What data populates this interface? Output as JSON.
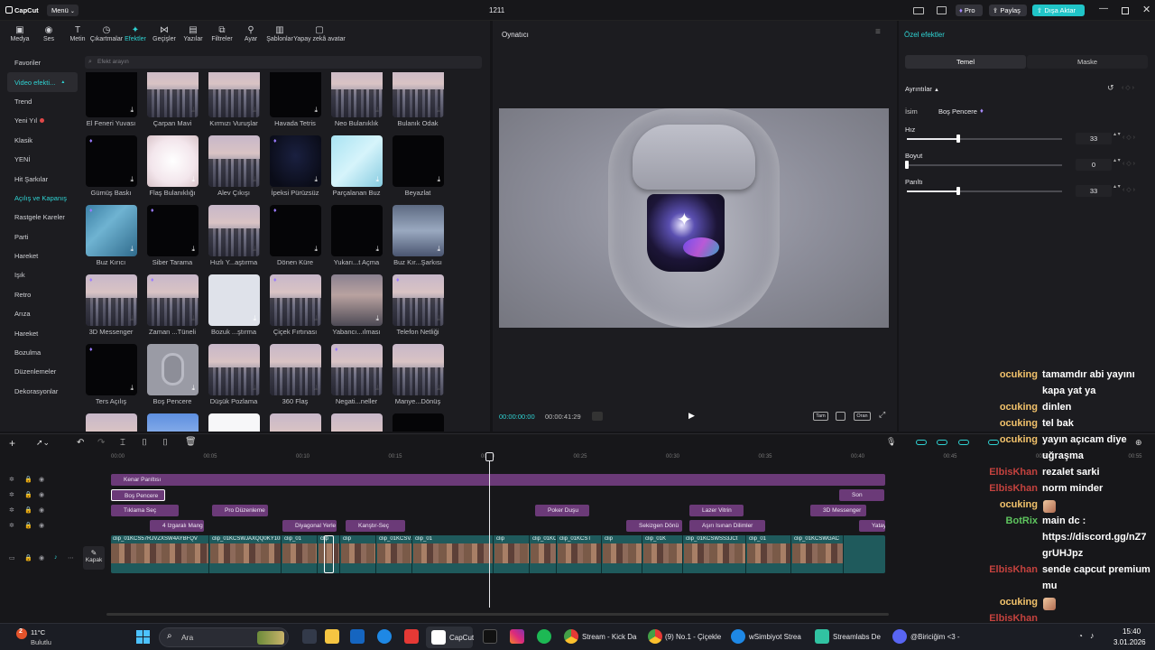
{
  "titlebar": {
    "app_name": "CapCut",
    "menu_label": "Menü",
    "project_title": "1211",
    "pro_label": "Pro",
    "share_label": "Paylaş",
    "export_label": "Dışa Aktar"
  },
  "toolbar": [
    {
      "label": "Medya",
      "icon": "media-icon"
    },
    {
      "label": "Ses",
      "icon": "audio-icon"
    },
    {
      "label": "Metin",
      "icon": "text-icon"
    },
    {
      "label": "Çıkartmalar",
      "icon": "sticker-icon"
    },
    {
      "label": "Efektler",
      "icon": "effects-icon",
      "active": true
    },
    {
      "label": "Geçişler",
      "icon": "transition-icon"
    },
    {
      "label": "Yazılar",
      "icon": "captions-icon"
    },
    {
      "label": "Filtreler",
      "icon": "filter-icon"
    },
    {
      "label": "Ayar",
      "icon": "adjust-icon"
    },
    {
      "label": "Şablonlar",
      "icon": "template-icon"
    },
    {
      "label": "Yapay zekâ avatar",
      "icon": "ai-avatar-icon"
    }
  ],
  "categories": [
    {
      "label": "Favoriler"
    },
    {
      "label": "Video efekti...",
      "teal": true,
      "selected": true
    },
    {
      "label": "Trend"
    },
    {
      "label": "Yeni Yıl"
    },
    {
      "label": "Klasik"
    },
    {
      "label": "YENİ"
    },
    {
      "label": "Hit Şarkılar"
    },
    {
      "label": "Açılış ve Kapanış",
      "teal": true
    },
    {
      "label": "Rastgele Kareler"
    },
    {
      "label": "Parti"
    },
    {
      "label": "Hareket"
    },
    {
      "label": "Işık"
    },
    {
      "label": "Retro"
    },
    {
      "label": "Arıza"
    },
    {
      "label": "Hareket"
    },
    {
      "label": "Bozulma"
    },
    {
      "label": "Düzenlemeler"
    },
    {
      "label": "Dekorasyonlar"
    }
  ],
  "categories_footer": "Gövde efekt...",
  "search_placeholder": "Efekt arayın",
  "effects": [
    {
      "label": "El Feneri Yuvası",
      "style": "dark"
    },
    {
      "label": "Çarpan Mavi",
      "style": "city"
    },
    {
      "label": "Kırmızı Vuruşlar",
      "style": "city"
    },
    {
      "label": "Havada Tetris",
      "style": "dark"
    },
    {
      "label": "Neo Bulanıklık",
      "style": "city"
    },
    {
      "label": "Bulanık Odak",
      "style": "city"
    },
    {
      "label": "Gümüş Baskı",
      "style": "dark"
    },
    {
      "label": "Flaş Bulanıklığı",
      "style": "flash"
    },
    {
      "label": "Alev Çıkışı",
      "style": "city"
    },
    {
      "label": "İpeksi Pürüzsüz",
      "style": "silk"
    },
    {
      "label": "Parçalanan Buz",
      "style": "ice"
    },
    {
      "label": "Beyazlat",
      "style": "dark"
    },
    {
      "label": "Buz Kırıcı",
      "style": "icebreak"
    },
    {
      "label": "Siber Tarama",
      "style": "dark"
    },
    {
      "label": "Hızlı Y...aştırma",
      "style": "city"
    },
    {
      "label": "Dönen Küre",
      "style": "dark"
    },
    {
      "label": "Yukarı...t Açma",
      "style": "dark"
    },
    {
      "label": "Buz Kır...Şarkısı",
      "style": "icecity"
    },
    {
      "label": "3D Messenger",
      "style": "city"
    },
    {
      "label": "Zaman ...Tüneli",
      "style": "city"
    },
    {
      "label": "Bozuk ...ştırma",
      "style": "pale"
    },
    {
      "label": "Çiçek Fırtınası",
      "style": "city"
    },
    {
      "label": "Yabancı...ılması",
      "style": "blurcity"
    },
    {
      "label": "Telefon Netliği",
      "style": "city"
    },
    {
      "label": "Ters Açılış",
      "style": "dark"
    },
    {
      "label": "Boş Pencere",
      "style": "window"
    },
    {
      "label": "Düşük Pozlama",
      "style": "city"
    },
    {
      "label": "360 Flaş",
      "style": "city"
    },
    {
      "label": "Negati...neller",
      "style": "city"
    },
    {
      "label": "Manye...Dönüş",
      "style": "city"
    },
    {
      "label": "",
      "style": "city"
    },
    {
      "label": "",
      "style": "sky"
    },
    {
      "label": "",
      "style": "white"
    },
    {
      "label": "",
      "style": "city"
    },
    {
      "label": "",
      "style": "city"
    },
    {
      "label": "",
      "style": "dark"
    }
  ],
  "player": {
    "title": "Oynatıcı",
    "time_current": "00:00:00:00",
    "time_total": "00:00:41:29",
    "btn_full": "Tam",
    "btn_ratio": "Oran"
  },
  "right_panel": {
    "title": "Özel efektler",
    "tab_basic": "Temel",
    "tab_mask": "Maske",
    "details_label": "Ayrıntılar",
    "name_label": "İsim",
    "name_value": "Boş Pencere",
    "params": [
      {
        "label": "Hız",
        "value": "33",
        "fraction": 0.33
      },
      {
        "label": "Boyut",
        "value": "0",
        "fraction": 0.0
      },
      {
        "label": "Parıltı",
        "value": "33",
        "fraction": 0.33
      }
    ]
  },
  "timeline": {
    "ruler": [
      "00:00",
      "00:05",
      "00:10",
      "00:15",
      "00:20",
      "00:25",
      "00:30",
      "00:35",
      "00:40",
      "00:45",
      "00:50",
      "00:55"
    ],
    "cover_label": "Kapak",
    "track1": [
      "Kenar Parıltısı"
    ],
    "track2": [
      "Boş Pencere",
      "Son"
    ],
    "track3": [
      "Tıklama Seç",
      "Pro Düzenleme",
      "Poker Duşu",
      "Lazer Vitrin",
      "3D Messenger"
    ],
    "track4": [
      "4 Izgaralı Mang",
      "Diyagonal Yerle",
      "Kanştır-Seç",
      "Sekizgen Dönü",
      "Aşırı Isınan Dilimler",
      "Yatay"
    ],
    "video_clips": [
      "clip_01KCS57RJVZXSW4AYBFQV",
      "clip_01KCSWJAXQQ0KY10P0",
      "clip_01",
      "clip",
      "clip",
      "clip_01KCSVZTJ3W9e2",
      "clip_01",
      "clip",
      "clip_01KCS",
      "clip_01KCST",
      "clip",
      "clip_01K",
      "clip_01KCSWSS3JCt",
      "clip_01",
      "clip_01KCSWGAC"
    ]
  },
  "chat": [
    {
      "user": "ocuking",
      "color": "org",
      "text": "tamamdır abi yayını"
    },
    {
      "user": "",
      "color": "org",
      "text": "kapa yat ya"
    },
    {
      "user": "ocuking",
      "color": "org",
      "text": "dinlen"
    },
    {
      "user": "ocuking",
      "color": "org",
      "text": "tel bak"
    },
    {
      "user": "ocuking",
      "color": "org",
      "text": "yayın açıcam diye"
    },
    {
      "user": "",
      "color": "org",
      "text": "uğraşma"
    },
    {
      "user": "ElbisKhan",
      "color": "red",
      "text": "rezalet sarki"
    },
    {
      "user": "ElbisKhan",
      "color": "red",
      "text": "norm minder"
    },
    {
      "user": "ocuking",
      "color": "org",
      "text": ""
    },
    {
      "user": "BotRix",
      "color": "grn",
      "text": "main dc :"
    },
    {
      "user": "",
      "color": "grn",
      "text": "https://discord.gg/nZ7"
    },
    {
      "user": "",
      "color": "grn",
      "text": "grUHJpz"
    },
    {
      "user": "ElbisKhan",
      "color": "red",
      "text": "sende capcut premium"
    },
    {
      "user": "",
      "color": "red",
      "text": "mu"
    },
    {
      "user": "ocuking",
      "color": "org",
      "text": ""
    },
    {
      "user": "ElbisKhan",
      "color": "red",
      "text": ""
    },
    {
      "user": "ocuking",
      "color": "org",
      "text": ""
    }
  ],
  "taskbar": {
    "weather_temp": "11°C",
    "weather_desc": "Bulutlu",
    "search_placeholder": "Ara",
    "apps": [
      {
        "label": "CapCut"
      },
      {
        "label": "Stream - Kick Da"
      },
      {
        "label": "(9) No.1 - Çiçekle"
      },
      {
        "label": "wSimbiyot Strea"
      },
      {
        "label": "Streamlabs De"
      },
      {
        "label": "@Biriciğim <3 -"
      }
    ],
    "time": "15:40",
    "date": "3.01.2026",
    "notify_count": "2"
  }
}
